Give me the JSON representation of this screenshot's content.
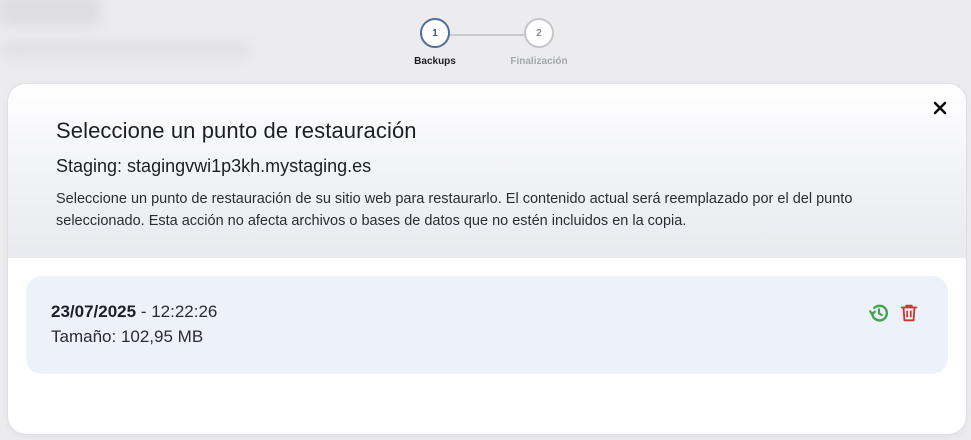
{
  "stepper": {
    "steps": [
      {
        "number": "1",
        "label": "Backups"
      },
      {
        "number": "2",
        "label": "Finalización"
      }
    ]
  },
  "modal": {
    "title": "Seleccione un punto de restauración",
    "subtitle": "Staging: stagingvwi1p3kh.mystaging.es",
    "description": "Seleccione un punto de restauración de su sitio web para restaurarlo. El contenido actual será reemplazado por el del punto seleccionado. Esta acción no afecta archivos o bases de datos que no estén incluidos en la copia.",
    "close_icon": "close-icon"
  },
  "backups": [
    {
      "date": "23/07/2025",
      "separator": " - ",
      "time": "12:22:26",
      "size_label": "Tamaño: ",
      "size": "102,95 MB",
      "restore_icon": "restore-history-icon",
      "delete_icon": "trash-icon"
    }
  ],
  "colors": {
    "step_active_border": "#4f6f94",
    "card_bg": "#edf1f9",
    "restore_icon": "#3fa64a",
    "delete_icon": "#d6322b"
  }
}
